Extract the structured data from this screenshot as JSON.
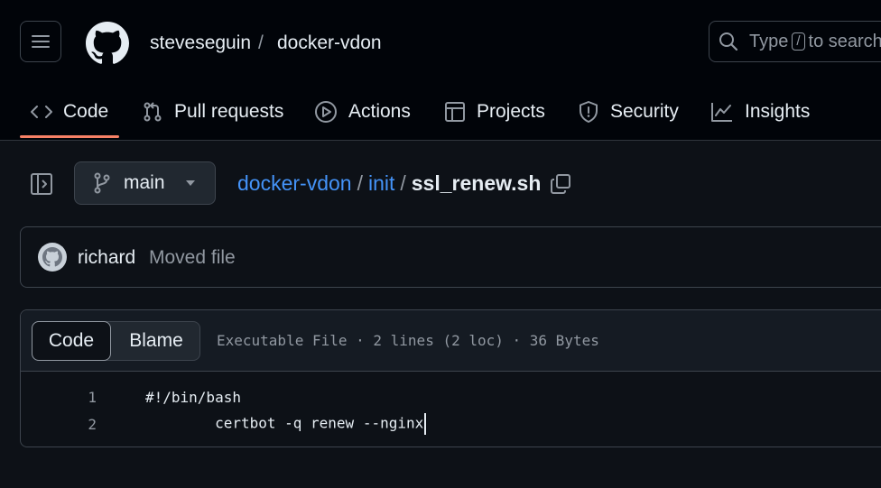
{
  "header": {
    "menu_icon": "hamburger-icon",
    "logo_icon": "github-logo-icon",
    "owner": "steveseguin",
    "separator": "/",
    "repo": "docker-vdon",
    "search": {
      "prefix": "Type",
      "key": "/",
      "suffix": "to search"
    }
  },
  "nav": {
    "tabs": [
      {
        "label": "Code",
        "icon": "code-icon",
        "active": true
      },
      {
        "label": "Pull requests",
        "icon": "pull-request-icon"
      },
      {
        "label": "Actions",
        "icon": "play-icon"
      },
      {
        "label": "Projects",
        "icon": "table-icon"
      },
      {
        "label": "Security",
        "icon": "shield-icon"
      },
      {
        "label": "Insights",
        "icon": "graph-icon"
      }
    ]
  },
  "file_nav": {
    "branch": "main",
    "breadcrumb": {
      "repo": "docker-vdon",
      "sep1": "/",
      "dir": "init",
      "sep2": "/",
      "file": "ssl_renew.sh"
    }
  },
  "commit": {
    "author": "richard",
    "message": "Moved file"
  },
  "file": {
    "view_tabs": {
      "code": "Code",
      "blame": "Blame"
    },
    "info": "Executable File · 2 lines (2 loc) · 36 Bytes",
    "lines": [
      {
        "num": "1",
        "text": "#!/bin/bash"
      },
      {
        "num": "2",
        "text": "certbot -q renew --nginx"
      }
    ]
  },
  "colors": {
    "accent_underline": "#f78166",
    "link": "#4493f8",
    "background": "#0d1117"
  }
}
